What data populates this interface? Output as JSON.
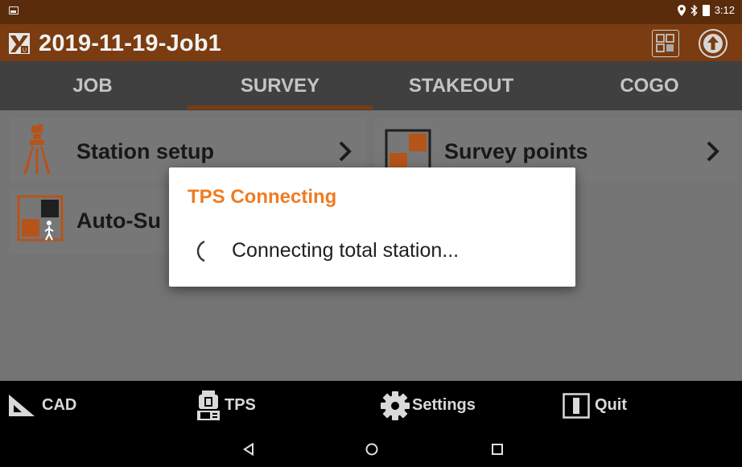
{
  "status_bar": {
    "time": "3:12",
    "icons": [
      "image-icon",
      "location-icon",
      "bluetooth-icon",
      "battery-icon"
    ]
  },
  "app_bar": {
    "title": "2019-11-19-Job1",
    "icons": [
      "app-logo-icon",
      "grid-code-icon",
      "upload-globe-icon"
    ]
  },
  "tabs": [
    {
      "label": "JOB",
      "active": false
    },
    {
      "label": "SURVEY",
      "active": true
    },
    {
      "label": "STAKEOUT",
      "active": false
    },
    {
      "label": "COGO",
      "active": false
    }
  ],
  "tiles": [
    {
      "label": "Station setup",
      "icon": "tripod-icon"
    },
    {
      "label": "Survey points",
      "icon": "survey-points-icon"
    },
    {
      "label": "Auto-Su",
      "icon": "auto-survey-icon"
    }
  ],
  "bottom_bar": [
    {
      "label": "CAD",
      "icon": "ruler-triangle-icon"
    },
    {
      "label": "TPS",
      "icon": "total-station-icon"
    },
    {
      "label": "Settings",
      "icon": "gear-icon"
    },
    {
      "label": "Quit",
      "icon": "quit-icon"
    }
  ],
  "nav_bar": [
    "back-icon",
    "home-icon",
    "recents-icon"
  ],
  "dialog": {
    "title": "TPS Connecting",
    "message": "Connecting total station..."
  },
  "colors": {
    "accent": "#ef7c22",
    "app_bar": "#7a3c10",
    "status_bar": "#5a2c0b",
    "tab_bar": "#404040",
    "icon_orange": "#b5541a"
  }
}
